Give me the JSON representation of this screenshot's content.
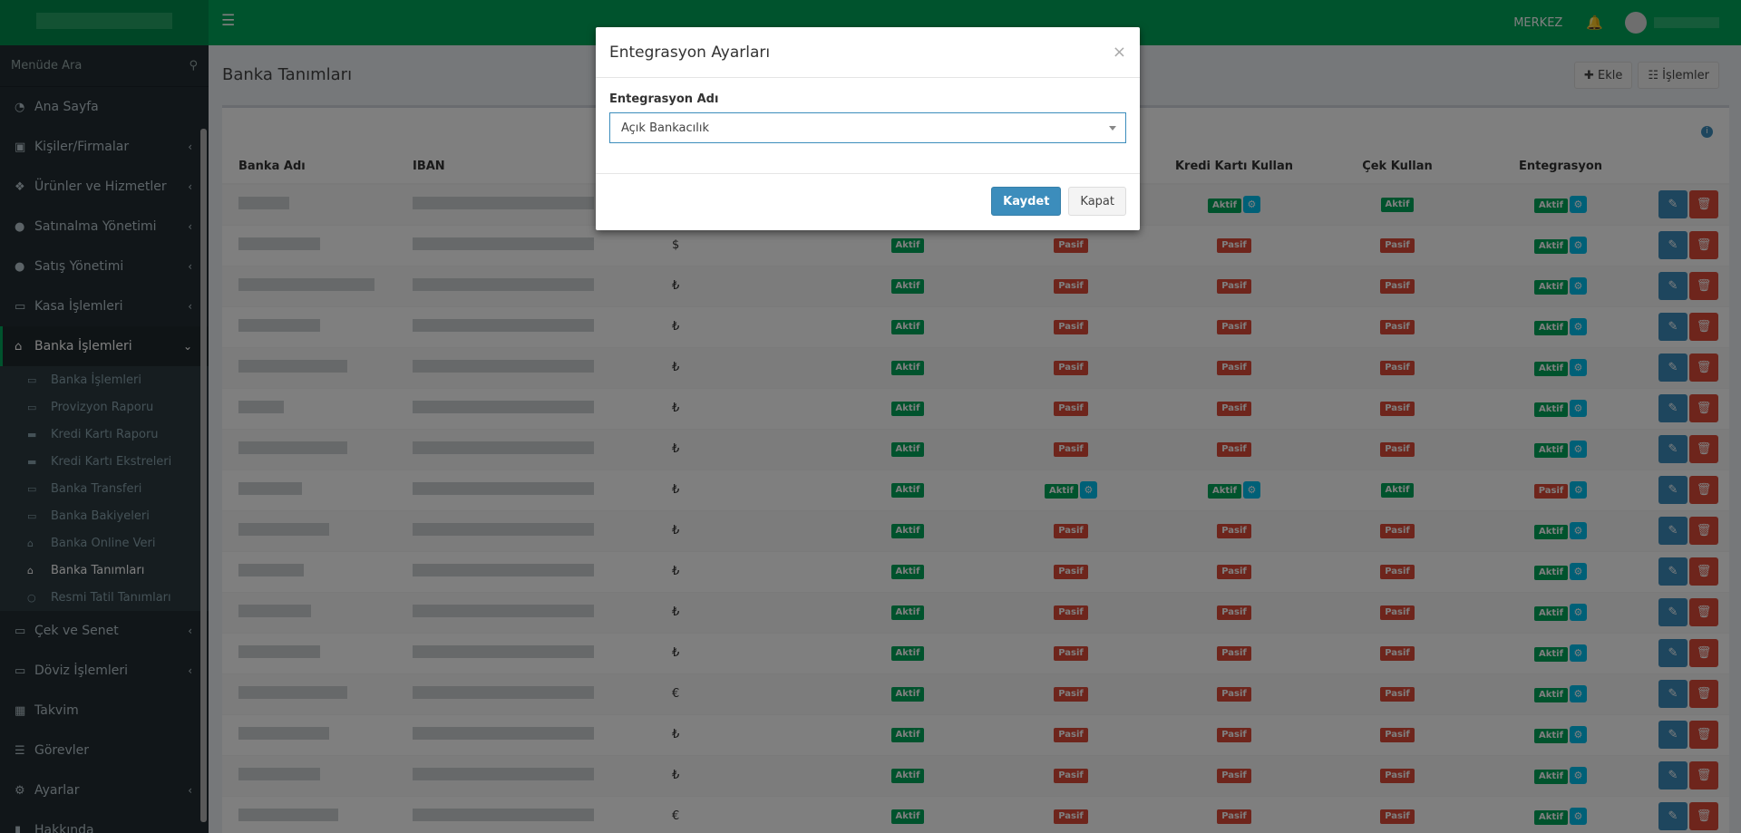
{
  "topbar": {
    "branch": "MERKEZ"
  },
  "sidebar": {
    "search_placeholder": "Menüde Ara",
    "items": [
      {
        "label": "Ana Sayfa",
        "icon": "dashboard-icon"
      },
      {
        "label": "Kişiler/Firmalar",
        "icon": "address-card-icon"
      },
      {
        "label": "Ürünler ve Hizmetler",
        "icon": "cubes-icon"
      },
      {
        "label": "Satınalma Yönetimi",
        "icon": "arrow-circle-down-icon"
      },
      {
        "label": "Satış Yönetimi",
        "icon": "arrow-circle-up-icon"
      },
      {
        "label": "Kasa İşlemleri",
        "icon": "money-icon"
      },
      {
        "label": "Banka İşlemleri",
        "icon": "bank-icon"
      }
    ],
    "subitems": [
      {
        "label": "Banka İşlemleri"
      },
      {
        "label": "Provizyon Raporu"
      },
      {
        "label": "Kredi Kartı Raporu"
      },
      {
        "label": "Kredi Kartı Ekstreleri"
      },
      {
        "label": "Banka Transferi"
      },
      {
        "label": "Banka Bakiyeleri"
      },
      {
        "label": "Banka Online Veri"
      },
      {
        "label": "Banka Tanımları"
      },
      {
        "label": "Resmi Tatil Tanımları"
      }
    ],
    "items2": [
      {
        "label": "Çek ve Senet"
      },
      {
        "label": "Döviz İşlemleri"
      },
      {
        "label": "Takvim"
      },
      {
        "label": "Görevler"
      },
      {
        "label": "Ayarlar"
      },
      {
        "label": "Hakkında"
      }
    ]
  },
  "page": {
    "title": "Banka Tanımları",
    "add_label": "Ekle",
    "ops_label": "İşlemler"
  },
  "table": {
    "headers": [
      "Banka Adı",
      "IBAN",
      "",
      "",
      "",
      "Kredi Kartı Kullan",
      "Çek Kullan",
      "Entegrasyon"
    ],
    "rows": [
      {
        "cur": "",
        "c1": "",
        "c2": "",
        "kk": "Aktif",
        "cek": "Aktif",
        "ent": "Aktif"
      },
      {
        "cur": "$",
        "c1": "Aktif",
        "c2": "Pasif",
        "kk": "Pasif",
        "cek": "Pasif",
        "ent": "Aktif"
      },
      {
        "cur": "₺",
        "c1": "Aktif",
        "c2": "Pasif",
        "kk": "Pasif",
        "cek": "Pasif",
        "ent": "Aktif"
      },
      {
        "cur": "₺",
        "c1": "Aktif",
        "c2": "Pasif",
        "kk": "Pasif",
        "cek": "Pasif",
        "ent": "Aktif"
      },
      {
        "cur": "₺",
        "c1": "Aktif",
        "c2": "Pasif",
        "kk": "Pasif",
        "cek": "Pasif",
        "ent": "Aktif"
      },
      {
        "cur": "₺",
        "c1": "Aktif",
        "c2": "Pasif",
        "kk": "Pasif",
        "cek": "Pasif",
        "ent": "Aktif"
      },
      {
        "cur": "₺",
        "c1": "Aktif",
        "c2": "Pasif",
        "kk": "Pasif",
        "cek": "Pasif",
        "ent": "Aktif"
      },
      {
        "cur": "₺",
        "c1": "Aktif",
        "c2": "Aktif",
        "kk": "Aktif",
        "cek": "Aktif",
        "ent": "Pasif"
      },
      {
        "cur": "₺",
        "c1": "Aktif",
        "c2": "Pasif",
        "kk": "Pasif",
        "cek": "Pasif",
        "ent": "Aktif"
      },
      {
        "cur": "₺",
        "c1": "Aktif",
        "c2": "Pasif",
        "kk": "Pasif",
        "cek": "Pasif",
        "ent": "Aktif"
      },
      {
        "cur": "₺",
        "c1": "Aktif",
        "c2": "Pasif",
        "kk": "Pasif",
        "cek": "Pasif",
        "ent": "Aktif"
      },
      {
        "cur": "₺",
        "c1": "Aktif",
        "c2": "Pasif",
        "kk": "Pasif",
        "cek": "Pasif",
        "ent": "Aktif"
      },
      {
        "cur": "€",
        "c1": "Aktif",
        "c2": "Pasif",
        "kk": "Pasif",
        "cek": "Pasif",
        "ent": "Aktif"
      },
      {
        "cur": "₺",
        "c1": "Aktif",
        "c2": "Pasif",
        "kk": "Pasif",
        "cek": "Pasif",
        "ent": "Aktif"
      },
      {
        "cur": "₺",
        "c1": "Aktif",
        "c2": "Pasif",
        "kk": "Pasif",
        "cek": "Pasif",
        "ent": "Aktif"
      },
      {
        "cur": "€",
        "c1": "Aktif",
        "c2": "Pasif",
        "kk": "Pasif",
        "cek": "Pasif",
        "ent": "Aktif"
      }
    ]
  },
  "modal": {
    "title": "Entegrasyon Ayarları",
    "close": "×",
    "field_label": "Entegrasyon Adı",
    "selected": "Açık Bankacılık",
    "save_label": "Kaydet",
    "close_label": "Kapat"
  },
  "colors": {
    "brand": "#00a65a",
    "primary": "#3c8dbc",
    "danger": "#dd4b39",
    "info": "#00c0ef"
  }
}
